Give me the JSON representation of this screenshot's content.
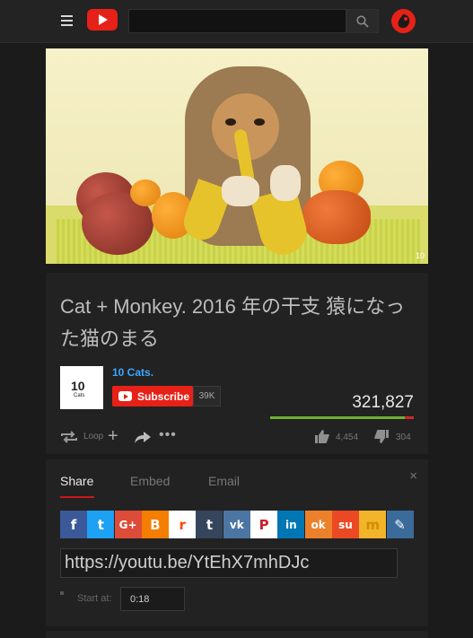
{
  "header": {
    "search_placeholder": ""
  },
  "video": {
    "watermark": "10"
  },
  "info": {
    "title": "Cat + Monkey. 2016 年の干支 猿になった猫のまる",
    "channel": {
      "name": "10 Cats.",
      "avatar_text": "10",
      "avatar_subtext": "Cats"
    },
    "subscribe_label": "Subscribe",
    "subscriber_count": "39K",
    "view_count": "321,827",
    "like_ratio": 0.936,
    "loop_label": "Loop",
    "likes": "4,454",
    "dislikes": "304"
  },
  "share": {
    "tabs": [
      "Share",
      "Embed",
      "Email"
    ],
    "close": "×",
    "services": [
      {
        "name": "facebook",
        "glyph": "f",
        "color": "#3b5998"
      },
      {
        "name": "twitter",
        "glyph": "t",
        "color": "#1da1f2"
      },
      {
        "name": "google-plus",
        "glyph": "G+",
        "color": "#dd4b39"
      },
      {
        "name": "blogger",
        "glyph": "B",
        "color": "#f57d00"
      },
      {
        "name": "reddit",
        "glyph": "r",
        "color": "#ffffff"
      },
      {
        "name": "tumblr",
        "glyph": "t",
        "color": "#35465c"
      },
      {
        "name": "vk",
        "glyph": "vk",
        "color": "#4c75a3"
      },
      {
        "name": "pinterest",
        "glyph": "P",
        "color": "#ffffff"
      },
      {
        "name": "linkedin",
        "glyph": "in",
        "color": "#0077b5"
      },
      {
        "name": "odnoklassniki",
        "glyph": "ok",
        "color": "#ed812b"
      },
      {
        "name": "stumbleupon",
        "glyph": "su",
        "color": "#eb4924"
      },
      {
        "name": "mixi",
        "glyph": "m",
        "color": "#f2b42a"
      },
      {
        "name": "livejournal",
        "glyph": "✎",
        "color": "#3b6b9a"
      }
    ],
    "url": "https://youtu.be/YtEhX7mhDJc",
    "start_at_label": "Start at:",
    "start_at_value": "0:18"
  }
}
